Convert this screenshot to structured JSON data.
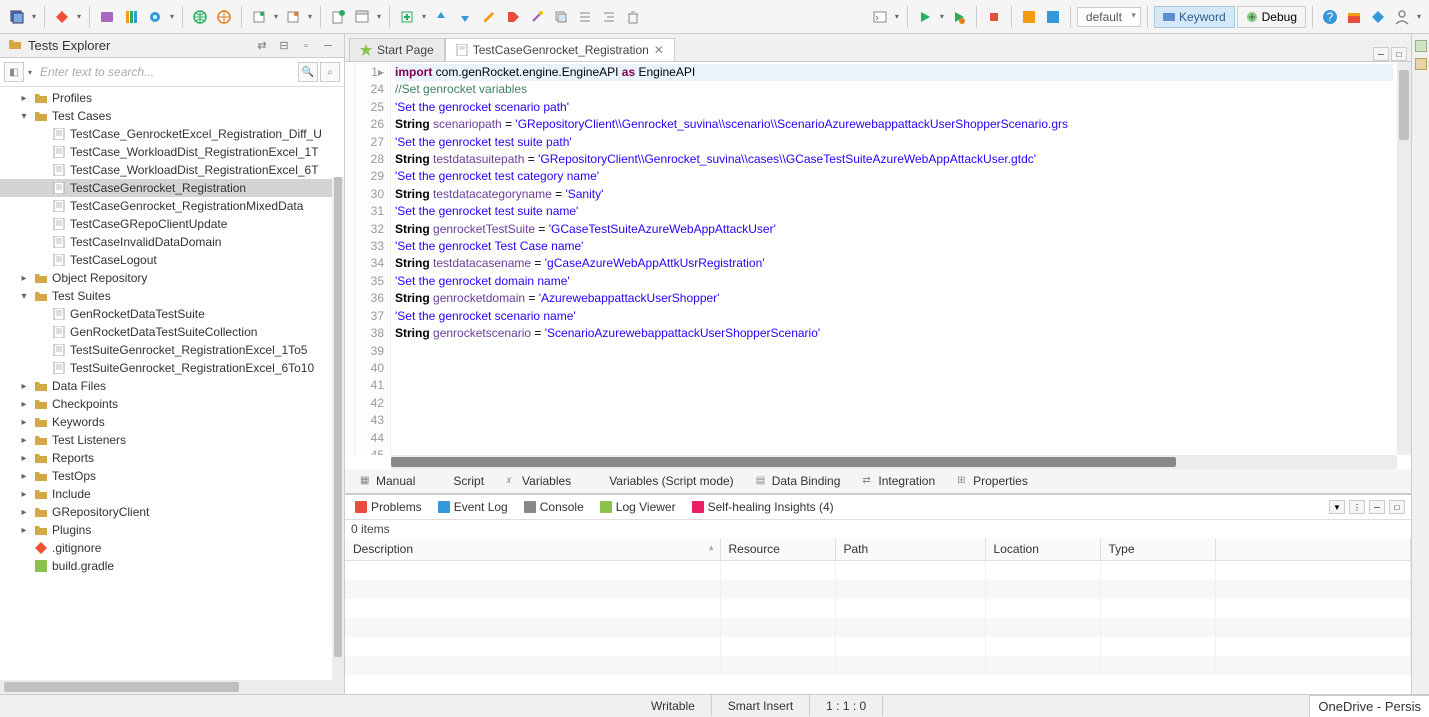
{
  "toolbar": {
    "profile": "default",
    "keyword_label": "Keyword",
    "debug_label": "Debug"
  },
  "sidebar": {
    "title": "Tests Explorer",
    "search_placeholder": "Enter text to search...",
    "items": [
      {
        "label": "Profiles",
        "type": "folder",
        "indent": 1,
        "exp": "▸"
      },
      {
        "label": "Test Cases",
        "type": "folder",
        "indent": 1,
        "exp": "▾"
      },
      {
        "label": "TestCase_GenrocketExcel_Registration_Diff_U",
        "type": "file",
        "indent": 2
      },
      {
        "label": "TestCase_WorkloadDist_RegistrationExcel_1T",
        "type": "file",
        "indent": 2
      },
      {
        "label": "TestCase_WorkloadDist_RegistrationExcel_6T",
        "type": "file",
        "indent": 2
      },
      {
        "label": "TestCaseGenrocket_Registration",
        "type": "file",
        "indent": 2,
        "selected": true
      },
      {
        "label": "TestCaseGenrocket_RegistrationMixedData",
        "type": "file",
        "indent": 2
      },
      {
        "label": "TestCaseGRepoClientUpdate",
        "type": "file",
        "indent": 2
      },
      {
        "label": "TestCaseInvalidDataDomain",
        "type": "file",
        "indent": 2
      },
      {
        "label": "TestCaseLogout",
        "type": "file",
        "indent": 2
      },
      {
        "label": "Object Repository",
        "type": "folder",
        "indent": 1,
        "exp": "▸"
      },
      {
        "label": "Test Suites",
        "type": "folder",
        "indent": 1,
        "exp": "▾"
      },
      {
        "label": "GenRocketDataTestSuite",
        "type": "file",
        "indent": 2
      },
      {
        "label": "GenRocketDataTestSuiteCollection",
        "type": "file",
        "indent": 2
      },
      {
        "label": "TestSuiteGenrocket_RegistrationExcel_1To5",
        "type": "file",
        "indent": 2
      },
      {
        "label": "TestSuiteGenrocket_RegistrationExcel_6To10",
        "type": "file",
        "indent": 2
      },
      {
        "label": "Data Files",
        "type": "folder",
        "indent": 1,
        "exp": "▸"
      },
      {
        "label": "Checkpoints",
        "type": "folder",
        "indent": 1,
        "exp": "▸"
      },
      {
        "label": "Keywords",
        "type": "folder",
        "indent": 1,
        "exp": "▸"
      },
      {
        "label": "Test Listeners",
        "type": "folder",
        "indent": 1,
        "exp": "▸"
      },
      {
        "label": "Reports",
        "type": "folder",
        "indent": 1,
        "exp": "▸"
      },
      {
        "label": "TestOps",
        "type": "folder",
        "indent": 1,
        "exp": "▸"
      },
      {
        "label": "Include",
        "type": "folder",
        "indent": 1,
        "exp": "▸"
      },
      {
        "label": "GRepositoryClient",
        "type": "folder",
        "indent": 1,
        "exp": "▸"
      },
      {
        "label": "Plugins",
        "type": "folder",
        "indent": 1,
        "exp": "▸"
      },
      {
        "label": ".gitignore",
        "type": "git",
        "indent": 1
      },
      {
        "label": "build.gradle",
        "type": "gradle",
        "indent": 1
      }
    ]
  },
  "tabs": [
    {
      "label": "Start Page",
      "active": false,
      "icon": "star"
    },
    {
      "label": "TestCaseGenrocket_Registration",
      "active": true,
      "close": true,
      "icon": "testcase"
    }
  ],
  "code": {
    "line_numbers": [
      "1",
      "24",
      "25",
      "26",
      "27",
      "28",
      "29",
      "30",
      "31",
      "32",
      "33",
      "34",
      "35",
      "36",
      "37",
      "38",
      "39",
      "40",
      "41",
      "42",
      "43",
      "44",
      "45"
    ],
    "lines": [
      {
        "hl": true,
        "tokens": [
          [
            "kw",
            "import"
          ],
          [
            "",
            " com.genRocket.engine.EngineAPI "
          ],
          [
            "kw",
            "as"
          ],
          [
            "",
            " EngineAPI"
          ]
        ]
      },
      {
        "tokens": [
          [
            "",
            ""
          ]
        ]
      },
      {
        "tokens": [
          [
            "cm",
            "//Set genrocket variables"
          ]
        ]
      },
      {
        "tokens": [
          [
            "str",
            "'Set the genrocket scenario path'"
          ]
        ]
      },
      {
        "tokens": [
          [
            "typ",
            "String"
          ],
          [
            "",
            " "
          ],
          [
            "var",
            "scenariopath"
          ],
          [
            "",
            " = "
          ],
          [
            "str",
            "'GRepositoryClient\\\\Genrocket_suvina\\\\scenario\\\\ScenarioAzurewebappattackUserShopperScenario.grs"
          ]
        ]
      },
      {
        "tokens": [
          [
            "",
            ""
          ]
        ]
      },
      {
        "tokens": [
          [
            "str",
            "'Set the genrocket test suite path'"
          ]
        ]
      },
      {
        "tokens": [
          [
            "typ",
            "String"
          ],
          [
            "",
            " "
          ],
          [
            "var",
            "testdatasuitepath"
          ],
          [
            "",
            " = "
          ],
          [
            "str",
            "'GRepositoryClient\\\\Genrocket_suvina\\\\cases\\\\GCaseTestSuiteAzureWebAppAttackUser.gtdc'"
          ]
        ]
      },
      {
        "tokens": [
          [
            "",
            ""
          ]
        ]
      },
      {
        "tokens": [
          [
            "str",
            "'Set the genrocket test category name'"
          ]
        ]
      },
      {
        "tokens": [
          [
            "typ",
            "String"
          ],
          [
            "",
            " "
          ],
          [
            "var",
            "testdatacategoryname"
          ],
          [
            "",
            " = "
          ],
          [
            "str",
            "'Sanity'"
          ]
        ]
      },
      {
        "tokens": [
          [
            "",
            ""
          ]
        ]
      },
      {
        "tokens": [
          [
            "str",
            "'Set the genrocket test suite name'"
          ]
        ]
      },
      {
        "tokens": [
          [
            "typ",
            "String"
          ],
          [
            "",
            " "
          ],
          [
            "var",
            "genrocketTestSuite"
          ],
          [
            "",
            " = "
          ],
          [
            "str",
            "'GCaseTestSuiteAzureWebAppAttackUser'"
          ]
        ]
      },
      {
        "tokens": [
          [
            "",
            ""
          ]
        ]
      },
      {
        "tokens": [
          [
            "str",
            "'Set the genrocket Test Case name'"
          ]
        ]
      },
      {
        "tokens": [
          [
            "typ",
            "String"
          ],
          [
            "",
            " "
          ],
          [
            "var",
            "testdatacasename"
          ],
          [
            "",
            " = "
          ],
          [
            "str",
            "'gCaseAzureWebAppAttkUsrRegistration'"
          ]
        ]
      },
      {
        "tokens": [
          [
            "",
            ""
          ]
        ]
      },
      {
        "tokens": [
          [
            "str",
            "'Set the genrocket domain name'"
          ]
        ]
      },
      {
        "tokens": [
          [
            "typ",
            "String"
          ],
          [
            "",
            " "
          ],
          [
            "var",
            "genrocketdomain"
          ],
          [
            "",
            " = "
          ],
          [
            "str",
            "'AzurewebappattackUserShopper'"
          ]
        ]
      },
      {
        "tokens": [
          [
            "",
            ""
          ]
        ]
      },
      {
        "tokens": [
          [
            "str",
            "'Set the genrocket scenario name'"
          ]
        ]
      },
      {
        "tokens": [
          [
            "typ",
            "String"
          ],
          [
            "",
            " "
          ],
          [
            "var",
            "genrocketscenario"
          ],
          [
            "",
            " = "
          ],
          [
            "str",
            "'ScenarioAzurewebappattackUserShopperScenario'"
          ]
        ]
      }
    ]
  },
  "subtabs": [
    "Manual",
    "Script",
    "Variables",
    "Variables (Script mode)",
    "Data Binding",
    "Integration",
    "Properties"
  ],
  "bottom": {
    "tabs": [
      {
        "label": "Problems"
      },
      {
        "label": "Event Log"
      },
      {
        "label": "Console"
      },
      {
        "label": "Log Viewer"
      },
      {
        "label": "Self-healing Insights (4)"
      }
    ],
    "items_label": "0 items",
    "columns": [
      "Description",
      "Resource",
      "Path",
      "Location",
      "Type"
    ]
  },
  "status": {
    "writable": "Writable",
    "insert": "Smart Insert",
    "pos": "1 : 1 : 0",
    "onedrive": "OneDrive - Persis"
  }
}
